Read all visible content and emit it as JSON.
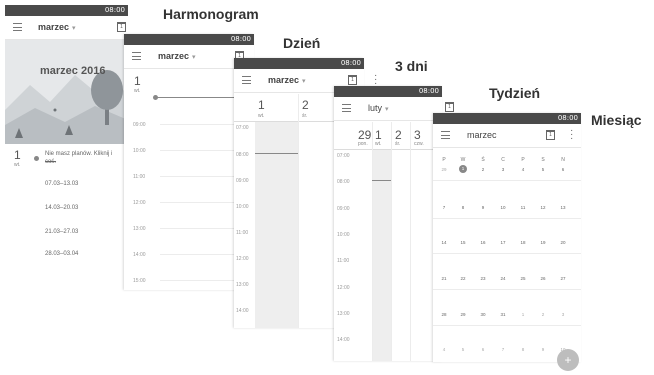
{
  "status_time": "08:00",
  "labels": {
    "schedule": "Harmonogram",
    "day": "Dzień",
    "three_days": "3 dni",
    "week": "Tydzień",
    "month": "Miesiąc"
  },
  "schedule_view": {
    "month": "marzec",
    "banner_title": "marzec 2016",
    "day_num": "1",
    "day_name": "wt.",
    "empty_text": "Nie masz planów. Kliknij i",
    "empty_text_2": "coś.",
    "weeks": [
      "07.03–13.03",
      "14.03–20.03",
      "21.03–27.03",
      "28.03–03.04"
    ]
  },
  "day_view": {
    "month": "marzec",
    "day_num": "1",
    "day_name": "wt.",
    "times": [
      "09:00",
      "10:00",
      "11:00",
      "12:00",
      "13:00",
      "14:00",
      "15:00"
    ]
  },
  "three_day_view": {
    "month": "marzec",
    "days": [
      {
        "num": "1",
        "name": "wt."
      },
      {
        "num": "2",
        "name": "śr."
      }
    ],
    "times": [
      "07:00",
      "08:00",
      "09:00",
      "10:00",
      "11:00",
      "12:00",
      "13:00",
      "14:00"
    ]
  },
  "week_view": {
    "month": "luty",
    "days": [
      {
        "num": "29",
        "name": "pon."
      },
      {
        "num": "1",
        "name": "wt."
      },
      {
        "num": "2",
        "name": "śr."
      },
      {
        "num": "3",
        "name": "czw."
      }
    ],
    "times": [
      "07:00",
      "08:00",
      "09:00",
      "10:00",
      "11:00",
      "12:00",
      "13:00",
      "14:00"
    ]
  },
  "month_view": {
    "month": "marzec",
    "weekday_headers": [
      "P",
      "W",
      "Ś",
      "C",
      "P",
      "S",
      "N"
    ],
    "weeks": [
      [
        "29",
        "1",
        "2",
        "3",
        "4",
        "5",
        "6"
      ],
      [
        "7",
        "8",
        "9",
        "10",
        "11",
        "12",
        "13"
      ],
      [
        "14",
        "15",
        "16",
        "17",
        "18",
        "19",
        "20"
      ],
      [
        "21",
        "22",
        "23",
        "24",
        "25",
        "26",
        "27"
      ],
      [
        "28",
        "29",
        "30",
        "31",
        "1",
        "2",
        "3"
      ],
      [
        "4",
        "5",
        "6",
        "7",
        "8",
        "9",
        "10"
      ]
    ],
    "today": "1",
    "fab_symbol": "+"
  },
  "calendar_icon_day": "1"
}
